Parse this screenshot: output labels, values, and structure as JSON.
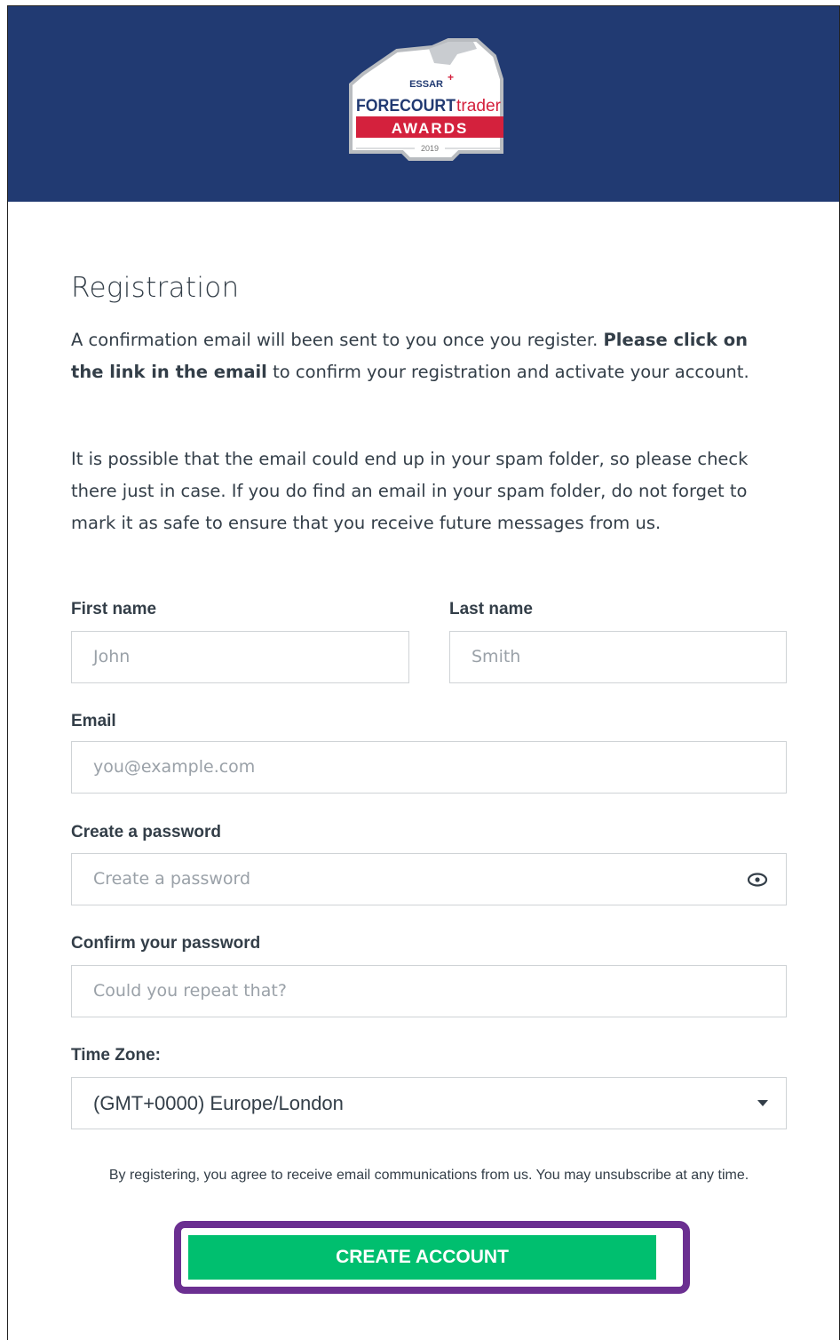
{
  "header": {
    "logo": {
      "top_text": "ESSAR",
      "main_text_bold": "FORECOURT",
      "main_text_light": "trader",
      "banner_text": "AWARDS",
      "year": "2019"
    },
    "colors": {
      "background": "#213a72",
      "banner": "#d4213d"
    }
  },
  "form": {
    "title": "Registration",
    "intro": {
      "part1": "A confirmation email will been sent to you once you register. ",
      "part2_bold": "Please click on the link in the email",
      "part3": " to confirm your registration and activate your account."
    },
    "spam_note": "It is possible that the email could end up in your spam folder, so please check there just in case. If you do find an email in your spam folder, do not forget to mark it as safe to ensure that you receive future messages from us.",
    "first_name": {
      "label": "First name",
      "placeholder": "John"
    },
    "last_name": {
      "label": "Last name",
      "placeholder": "Smith"
    },
    "email": {
      "label": "Email",
      "placeholder": "you@example.com"
    },
    "password": {
      "label": "Create a password",
      "placeholder": "Create a password",
      "icon": "eye-icon"
    },
    "confirm_password": {
      "label": "Confirm your password",
      "placeholder": "Could you repeat that?"
    },
    "timezone": {
      "label": "Time Zone:",
      "selected": "(GMT+0000) Europe/London",
      "icon": "caret-down-icon"
    },
    "consent": "By registering, you agree to receive email communications from us. You may unsubscribe at any time.",
    "submit": {
      "label": "CREATE ACCOUNT"
    }
  },
  "colors": {
    "accent_button": "#00bf6f",
    "highlight_border": "#6b2f91",
    "text": "#333e48"
  }
}
